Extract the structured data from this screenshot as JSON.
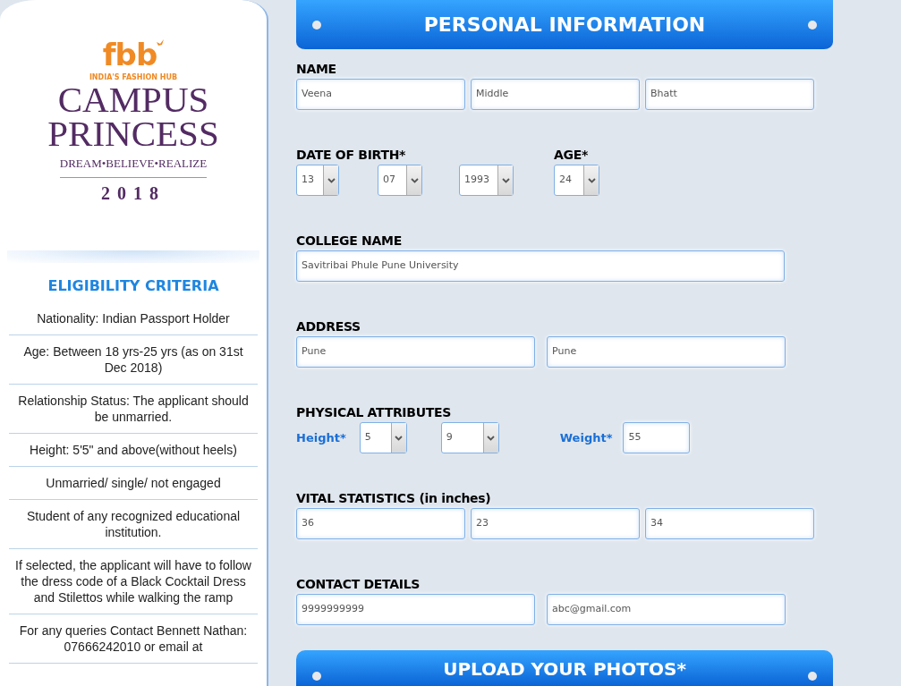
{
  "logo": {
    "brand": "fbb",
    "tagline": "INDIA'S FASHION HUB",
    "title_1": "CAMPUS",
    "title_2": "PRINCESS",
    "motto": "DREAM•BELIEVE•REALIZE",
    "year": "2018"
  },
  "eligibility": {
    "heading": "ELIGIBILITY CRITERIA",
    "items": [
      "Nationality: Indian Passport Holder",
      "Age: Between 18 yrs-25 yrs (as on 31st Dec 2018)",
      "Relationship Status: The applicant should be unmarried.",
      "Height: 5'5\" and above(without heels)",
      "Unmarried/ single/ not engaged",
      "Student of any recognized educational institution.",
      "If selected, the applicant will have to follow the dress code of a Black Cocktail Dress and Stilettos while walking the ramp",
      "For any queries Contact Bennett Nathan: 07666242010 or email at"
    ]
  },
  "banner": "PERSONAL INFORMATION",
  "sections": [
    {
      "kind": "triple",
      "labels": [
        "NAME"
      ],
      "fields": [
        {
          "kind": "text",
          "value": "Veena"
        },
        {
          "kind": "text",
          "value": "Middle"
        },
        {
          "kind": "text",
          "value": "Bhatt"
        }
      ]
    },
    {
      "kind": "dob",
      "labels": [
        "DATE OF BIRTH*",
        "AGE*"
      ],
      "fields": [
        {
          "kind": "select",
          "value": "13"
        },
        {
          "kind": "select",
          "value": "07"
        },
        {
          "kind": "select",
          "value": "1993"
        },
        {
          "kind": "select",
          "value": "24"
        }
      ]
    },
    {
      "kind": "wide",
      "labels": [
        "COLLEGE NAME"
      ],
      "fields": [
        {
          "kind": "text",
          "value": "Savitribai Phule Pune University"
        }
      ]
    },
    {
      "kind": "pair",
      "labels": [
        "ADDRESS"
      ],
      "fields": [
        {
          "kind": "text",
          "value": "Pune"
        },
        {
          "kind": "text",
          "value": "Pune"
        }
      ]
    },
    {
      "kind": "physical",
      "labels": [
        "PHYSICAL ATTRIBUTES"
      ],
      "fields": [
        {
          "kind": "label",
          "value": "Height*"
        },
        {
          "kind": "select",
          "value": "5"
        },
        {
          "kind": "select",
          "value": "9"
        },
        {
          "kind": "label",
          "value": "Weight*"
        },
        {
          "kind": "text",
          "value": "55"
        }
      ]
    },
    {
      "kind": "triple",
      "labels": [
        "VITAL STATISTICS (in inches)"
      ],
      "fields": [
        {
          "kind": "text",
          "value": "36"
        },
        {
          "kind": "text",
          "value": "23"
        },
        {
          "kind": "text",
          "value": "34"
        }
      ]
    },
    {
      "kind": "pair",
      "labels": [
        "CONTACT DETAILS"
      ],
      "fields": [
        {
          "kind": "text",
          "value": "9999999999"
        },
        {
          "kind": "text",
          "value": "abc@gmail.com"
        }
      ]
    }
  ],
  "next_banner": "UPLOAD YOUR PHOTOS*"
}
